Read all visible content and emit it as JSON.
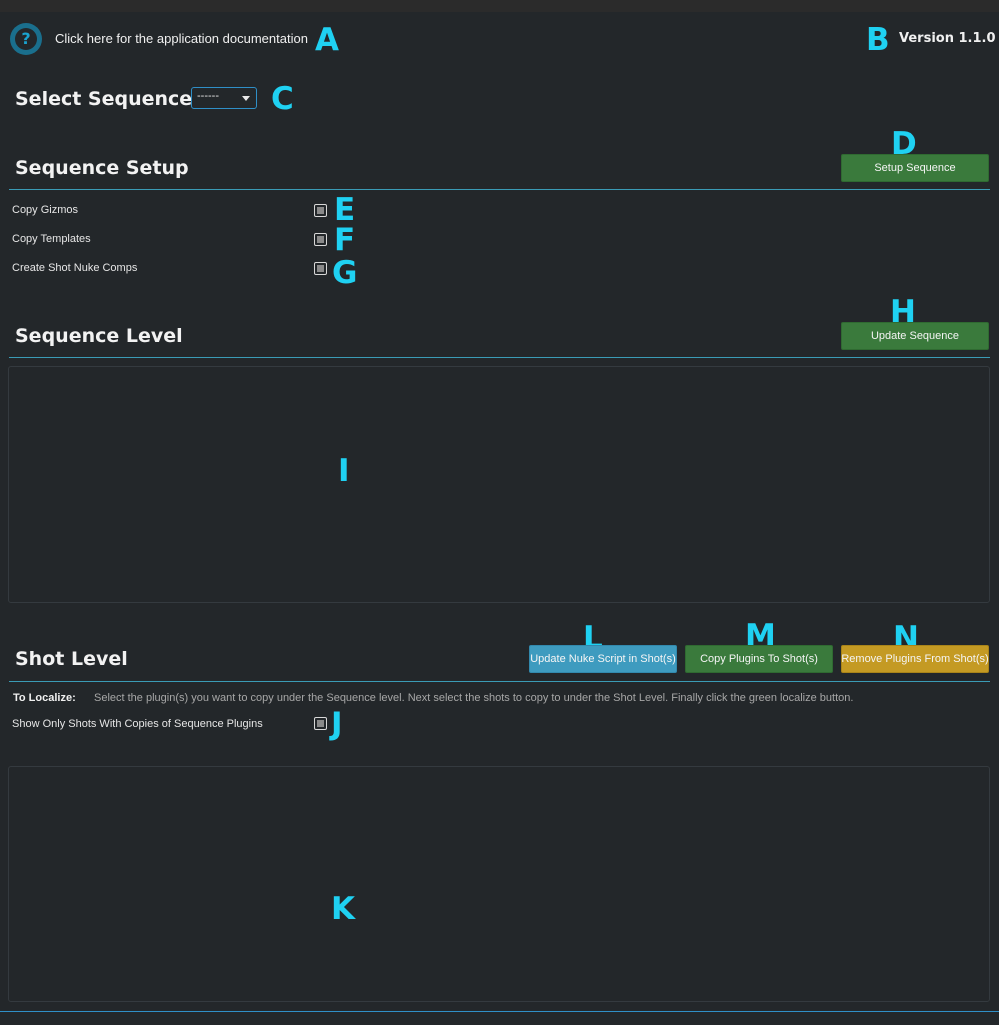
{
  "header": {
    "doc_link": "Click here for the application documentation",
    "version": "Version 1.1.0"
  },
  "select_sequence": {
    "label": "Select Sequence:",
    "value": "------"
  },
  "sequence_setup": {
    "title": "Sequence Setup",
    "button": "Setup Sequence",
    "options": [
      {
        "label": "Copy Gizmos"
      },
      {
        "label": "Copy Templates"
      },
      {
        "label": "Create Shot Nuke Comps"
      }
    ]
  },
  "sequence_level": {
    "title": "Sequence Level",
    "button": "Update Sequence"
  },
  "shot_level": {
    "title": "Shot Level",
    "buttons": {
      "update_nuke": "Update Nuke Script in Shot(s)",
      "copy_plugins": "Copy Plugins To Shot(s)",
      "remove_plugins": "Remove Plugins From Shot(s)"
    },
    "localize_label": "To Localize:",
    "localize_text": "Select the plugin(s) you want to copy under the Sequence level. Next select the shots to copy to under the Shot Level. Finally click the green localize button.",
    "filter_label": "Show Only Shots With Copies of Sequence Plugins"
  },
  "markers": {
    "a": "A",
    "b": "B",
    "c": "C",
    "d": "D",
    "e": "E",
    "f": "F",
    "g": "G",
    "h": "H",
    "i": "I",
    "j": "J",
    "k": "K",
    "l": "L",
    "m": "M",
    "n": "N"
  },
  "colors": {
    "background": "#23272a",
    "accent_rule": "#3a9bb5",
    "green_button": "#3a7a3c",
    "blue_button": "#3e9bbf",
    "gold_button": "#c49a23",
    "marker": "#1fd1f2"
  },
  "icons": {
    "help": "help-question-icon",
    "dropdown": "chevron-down-icon"
  }
}
